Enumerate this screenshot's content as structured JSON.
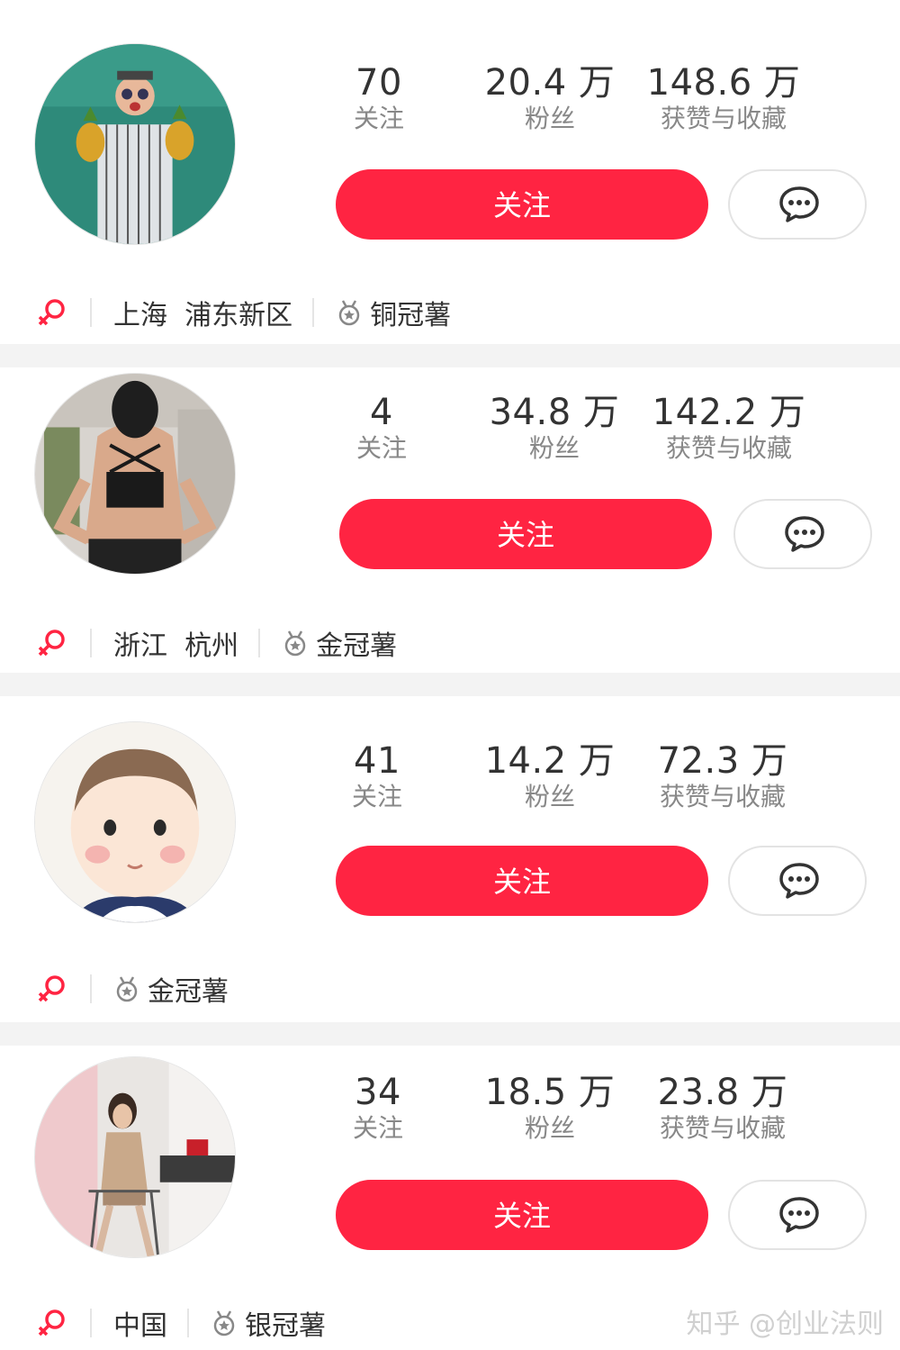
{
  "theme": {
    "accent": "#ff2442",
    "text": "#333333",
    "muted": "#888888"
  },
  "profiles": [
    {
      "stats": [
        {
          "value": "70",
          "label": "关注"
        },
        {
          "value": "20.4 万",
          "label": "粉丝"
        },
        {
          "value": "148.6 万",
          "label": "获赞与收藏"
        }
      ],
      "follow_label": "关注",
      "gender_icon": "female-icon",
      "location": "上海  浦东新区",
      "badge": "铜冠薯"
    },
    {
      "stats": [
        {
          "value": "4",
          "label": "关注"
        },
        {
          "value": "34.8 万",
          "label": "粉丝"
        },
        {
          "value": "142.2 万",
          "label": "获赞与收藏"
        }
      ],
      "follow_label": "关注",
      "gender_icon": "female-icon",
      "location": "浙江  杭州",
      "badge": "金冠薯"
    },
    {
      "stats": [
        {
          "value": "41",
          "label": "关注"
        },
        {
          "value": "14.2 万",
          "label": "粉丝"
        },
        {
          "value": "72.3 万",
          "label": "获赞与收藏"
        }
      ],
      "follow_label": "关注",
      "gender_icon": "female-icon",
      "location": "",
      "badge": "金冠薯"
    },
    {
      "stats": [
        {
          "value": "34",
          "label": "关注"
        },
        {
          "value": "18.5 万",
          "label": "粉丝"
        },
        {
          "value": "23.8 万",
          "label": "获赞与收藏"
        }
      ],
      "follow_label": "关注",
      "gender_icon": "female-icon",
      "location": "中国",
      "badge": "银冠薯"
    }
  ],
  "watermark": "知乎 @创业法则"
}
